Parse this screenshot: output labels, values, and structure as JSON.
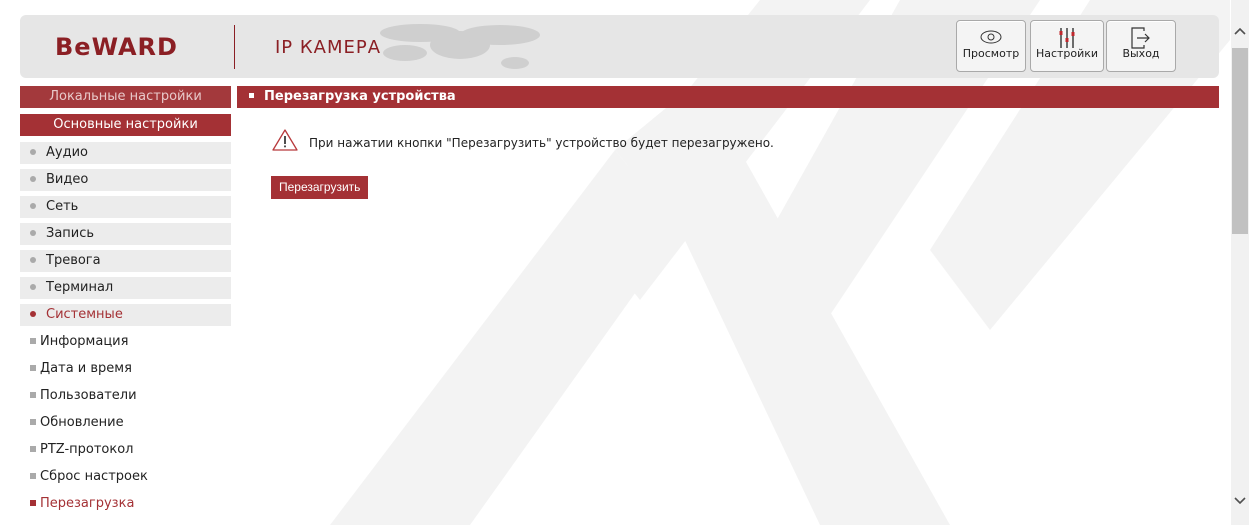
{
  "header": {
    "logo": "BeWARD",
    "product_title": "IP КАМЕРА",
    "buttons": {
      "view": "Просмотр",
      "settings": "Настройки",
      "exit": "Выход"
    }
  },
  "sidebar": {
    "local_settings": "Локальные настройки",
    "main_settings": "Основные настройки",
    "items": [
      {
        "label": "Аудио"
      },
      {
        "label": "Видео"
      },
      {
        "label": "Сеть"
      },
      {
        "label": "Запись"
      },
      {
        "label": "Тревога"
      },
      {
        "label": "Терминал"
      },
      {
        "label": "Системные"
      }
    ],
    "sub_items": [
      {
        "label": "Информация"
      },
      {
        "label": "Дата и время"
      },
      {
        "label": "Пользователи"
      },
      {
        "label": "Обновление"
      },
      {
        "label": "PTZ-протокол"
      },
      {
        "label": "Сброс настроек"
      },
      {
        "label": "Перезагрузка"
      }
    ]
  },
  "main": {
    "section_title": "Перезагрузка устройства",
    "notice": "При нажатии кнопки \"Перезагрузить\" устройство будет перезагружено.",
    "reboot_button": "Перезагрузить"
  },
  "colors": {
    "brand": "#a43135",
    "sidebar_item_bg": "#ececec",
    "header_bg": "#e6e6e6"
  },
  "icons": {
    "view": "eye-icon",
    "settings": "sliders-icon",
    "exit": "logout-icon",
    "notice": "warning-icon"
  }
}
